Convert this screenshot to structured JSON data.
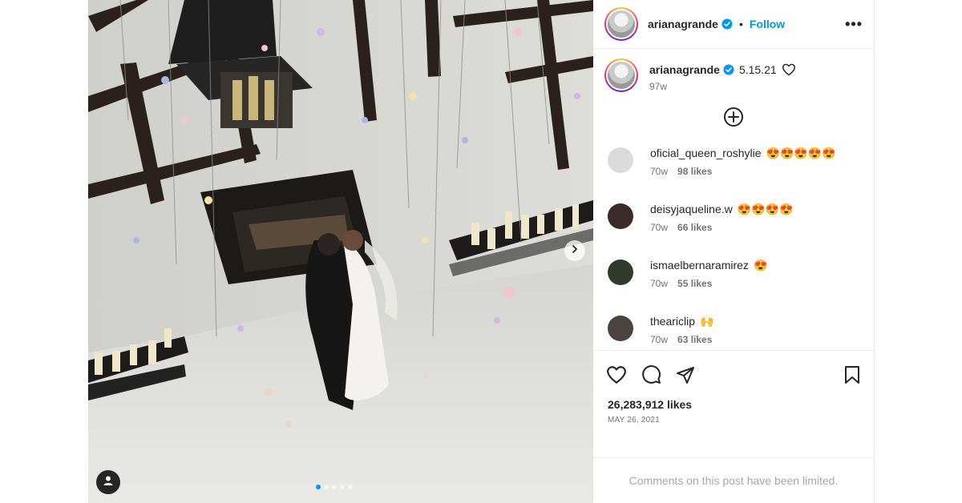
{
  "post": {
    "author": "arianagrande",
    "follow_label": "Follow",
    "separator": "•",
    "more_label": "•••"
  },
  "caption": {
    "username": "arianagrande",
    "text": "5.15.21",
    "time": "97w"
  },
  "comments": [
    {
      "username": "oficial_queen_roshylie",
      "text": "😍😍😍😍😍",
      "time": "70w",
      "likes": "98 likes",
      "avatar_color": "#dbdbdb"
    },
    {
      "username": "deisyjaqueline.w",
      "text": "😍😍😍😍",
      "time": "70w",
      "likes": "66 likes",
      "avatar_color": "#3a2a2a"
    },
    {
      "username": "ismaelbernaramirez",
      "text": "😍",
      "time": "70w",
      "likes": "55 likes",
      "avatar_color": "#2f3a2a"
    },
    {
      "username": "theariclip",
      "text": "🙌",
      "time": "70w",
      "likes": "63 likes",
      "avatar_color": "#4a4340"
    }
  ],
  "likes_count": "26,283,912 likes",
  "date": "MAY 26, 2021",
  "comments_limited": "Comments on this post have been limited.",
  "carousel": {
    "count": 5,
    "active": 0
  },
  "colors": {
    "accent": "#0095f6",
    "verified": "#0095f6",
    "secondary_text": "#737373",
    "limited_text": "#a8a8a8"
  },
  "icons": [
    "verified-badge-icon",
    "more-options-icon",
    "heart-icon",
    "plus-circle-icon",
    "comment-icon",
    "share-icon",
    "bookmark-icon",
    "user-tag-icon",
    "chevron-right-icon"
  ]
}
